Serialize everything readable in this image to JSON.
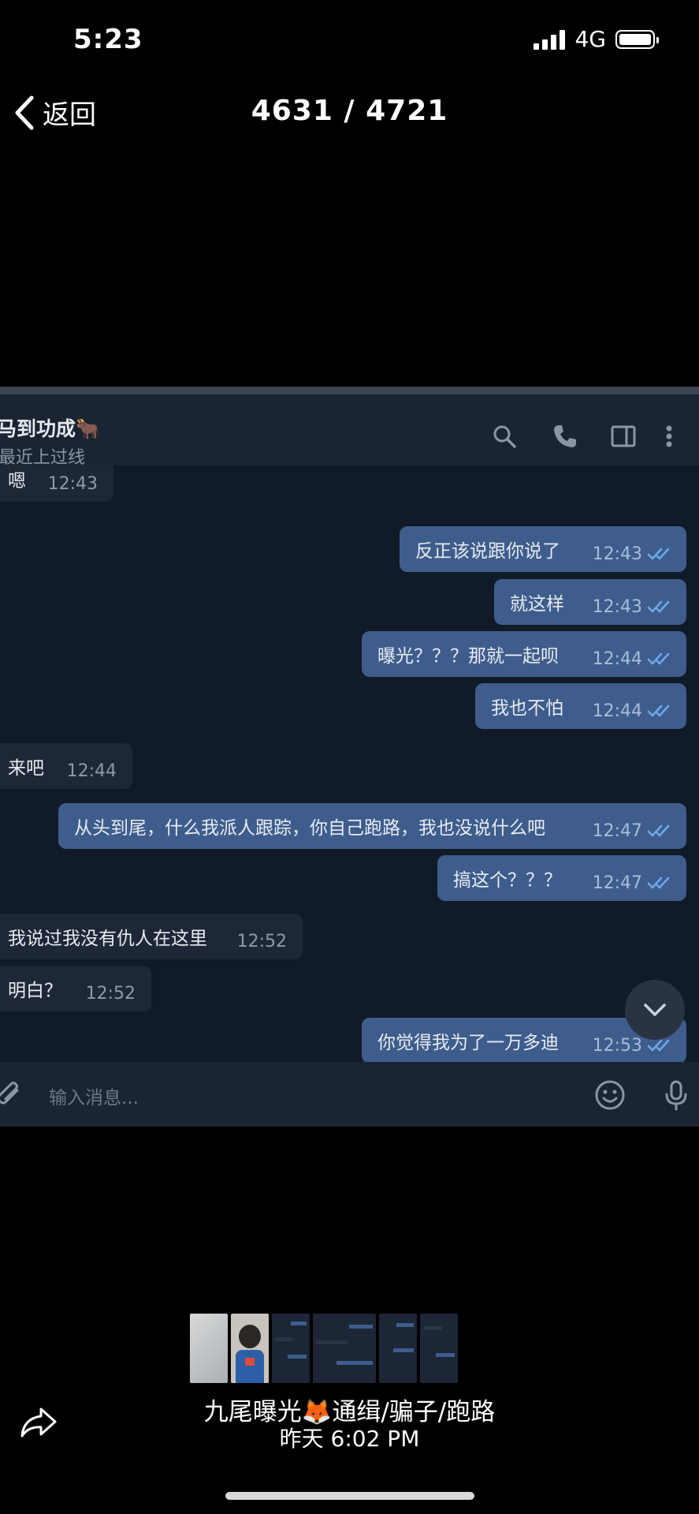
{
  "status_bar": {
    "time": "5:23",
    "network": "4G"
  },
  "nav": {
    "back_label": "返回",
    "title": "4631 / 4721"
  },
  "chat": {
    "name": "马到功成🐂",
    "last_seen": "最近上过线",
    "messages": [
      {
        "dir": "in",
        "text": "嗯",
        "time": "12:43"
      },
      {
        "dir": "out",
        "text": "反正该说跟你说了",
        "time": "12:43"
      },
      {
        "dir": "out",
        "text": "就这样",
        "time": "12:43"
      },
      {
        "dir": "out",
        "text": "曝光？？？那就一起呗",
        "time": "12:44"
      },
      {
        "dir": "out",
        "text": "我也不怕",
        "time": "12:44"
      },
      {
        "dir": "in",
        "text": "来吧",
        "time": "12:44"
      },
      {
        "dir": "out",
        "text": "从头到尾，什么我派人跟踪，你自己跑路，我也没说什么吧",
        "time": "12:47"
      },
      {
        "dir": "out",
        "text": "搞这个？？？",
        "time": "12:47"
      },
      {
        "dir": "in",
        "text": "我说过我没有仇人在这里",
        "time": "12:52"
      },
      {
        "dir": "in",
        "text": "明白？",
        "time": "12:52"
      },
      {
        "dir": "out",
        "text": "你觉得我为了一万多迪",
        "time": "12:53"
      }
    ],
    "input_placeholder": "输入消息..."
  },
  "album": {
    "title": "九尾曝光🦊通缉/骗子/跑路",
    "date": "昨天 6:02 PM"
  },
  "colors": {
    "chat_bg": "#111a27",
    "bubble_in": "#1d2737",
    "bubble_out": "#3e5d8c",
    "tick_blue": "#6ea8e8"
  }
}
